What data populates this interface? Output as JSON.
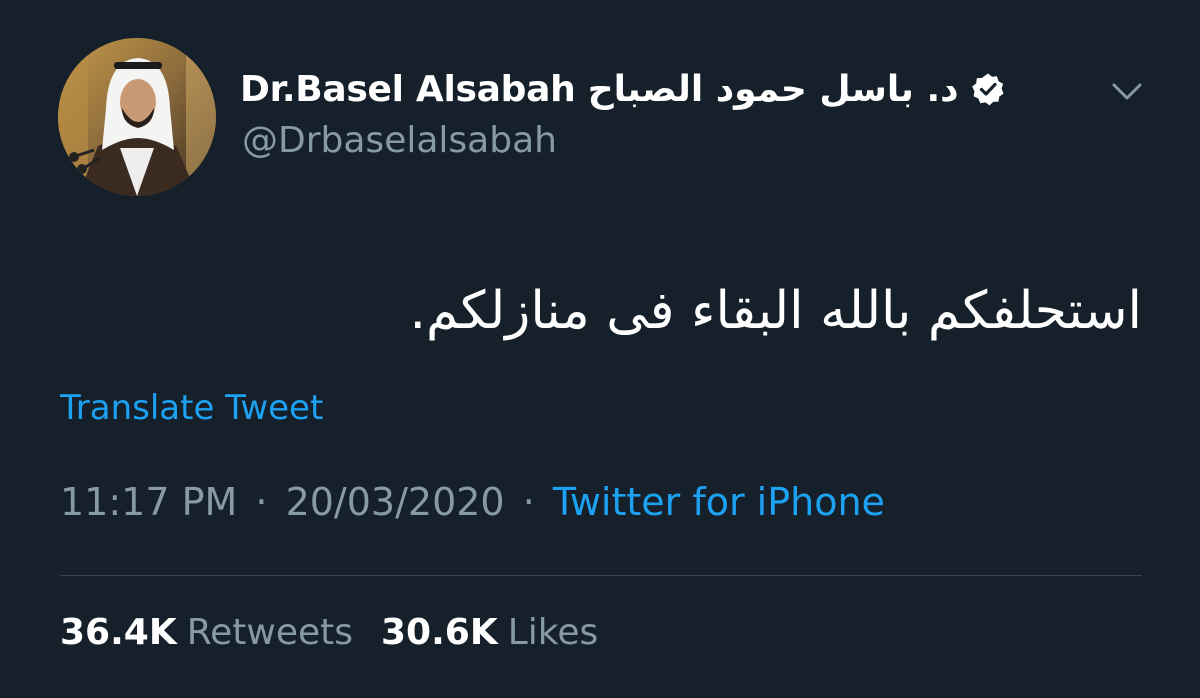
{
  "author": {
    "display_name": "Dr.Basel Alsabah د. باسل حمود الصباح",
    "handle": "@Drbaselalsabah",
    "verified": true,
    "avatar_icon": "profile-photo"
  },
  "icons": {
    "verified": "verified-badge-icon",
    "menu": "chevron-down-icon"
  },
  "tweet": {
    "text": "استحلفكم بالله البقاء فى منازلكم.",
    "translate_label": "Translate Tweet",
    "time": "11:17 PM",
    "date": "20/03/2020",
    "separator": "·",
    "source": "Twitter for iPhone"
  },
  "stats": {
    "retweets_count": "36.4K",
    "retweets_label": "Retweets",
    "likes_count": "30.6K",
    "likes_label": "Likes"
  },
  "colors": {
    "background": "#15202b",
    "primary_text": "#ffffff",
    "secondary_text": "#8899a6",
    "accent": "#1da1f2",
    "divider": "#38444d"
  }
}
